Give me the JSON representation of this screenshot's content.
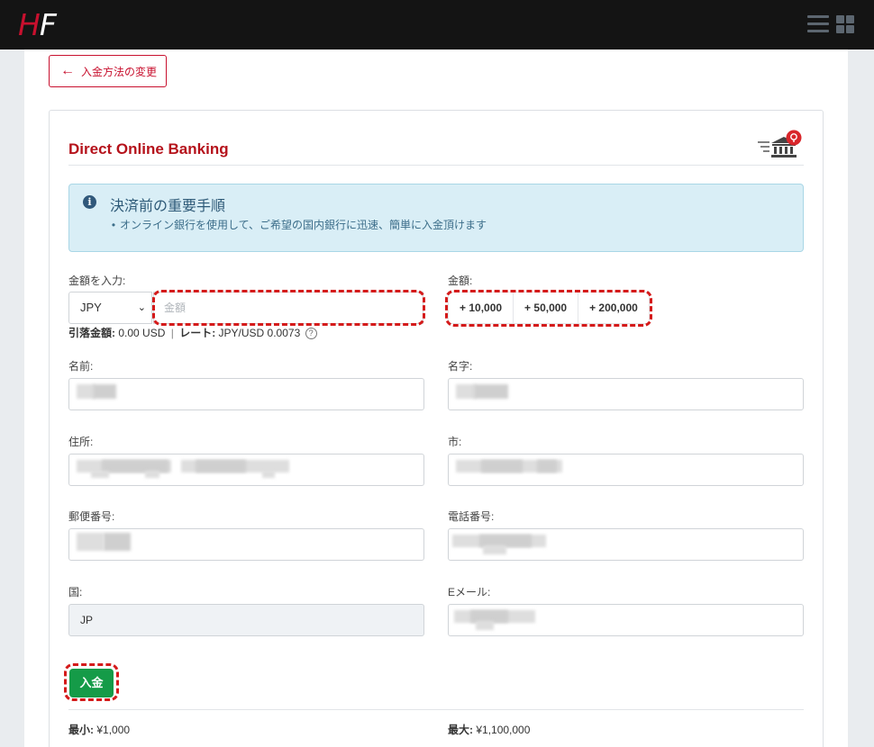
{
  "header": {
    "logo_h": "H",
    "logo_f": "F"
  },
  "back_button": {
    "label": "入金方法の変更"
  },
  "card": {
    "title": "Direct Online Banking"
  },
  "alert": {
    "title": "決済前の重要手順",
    "body": "オンライン銀行を使用して、ご希望の国内銀行に迅速、簡単に入金頂けます"
  },
  "amount": {
    "label": "金額を入力:",
    "currency": "JPY",
    "placeholder": "金額"
  },
  "quick_amounts": {
    "label": "金額:",
    "buttons": [
      "+ 10,000",
      "+ 50,000",
      "+ 200,000"
    ]
  },
  "debit": {
    "label": "引落金額:",
    "value": "0.00 USD",
    "separator": "|",
    "rate_label": "レート:",
    "rate_value": "JPY/USD 0.0073"
  },
  "form": {
    "first_name_label": "名前:",
    "last_name_label": "名字:",
    "address_label": "住所:",
    "city_label": "市:",
    "postal_label": "郵便番号:",
    "phone_label": "電話番号:",
    "country_label": "国:",
    "country_value": "JP",
    "email_label": "Eメール:"
  },
  "submit": {
    "label": "入金"
  },
  "limits": {
    "min_label": "最小:",
    "min_value": "¥1,000",
    "max_label": "最大:",
    "max_value": "¥1,100,000"
  },
  "colors": {
    "brand_red": "#c8102e",
    "title_red": "#b5121b",
    "submit_green": "#159b48",
    "highlight_red": "#d41a1a",
    "alert_bg": "#d9eef6"
  },
  "icons": [
    "back-arrow-icon",
    "hamburger-menu-icon",
    "grid-apps-icon",
    "bank-location-icon",
    "info-icon",
    "help-icon",
    "chevron-down-icon"
  ]
}
